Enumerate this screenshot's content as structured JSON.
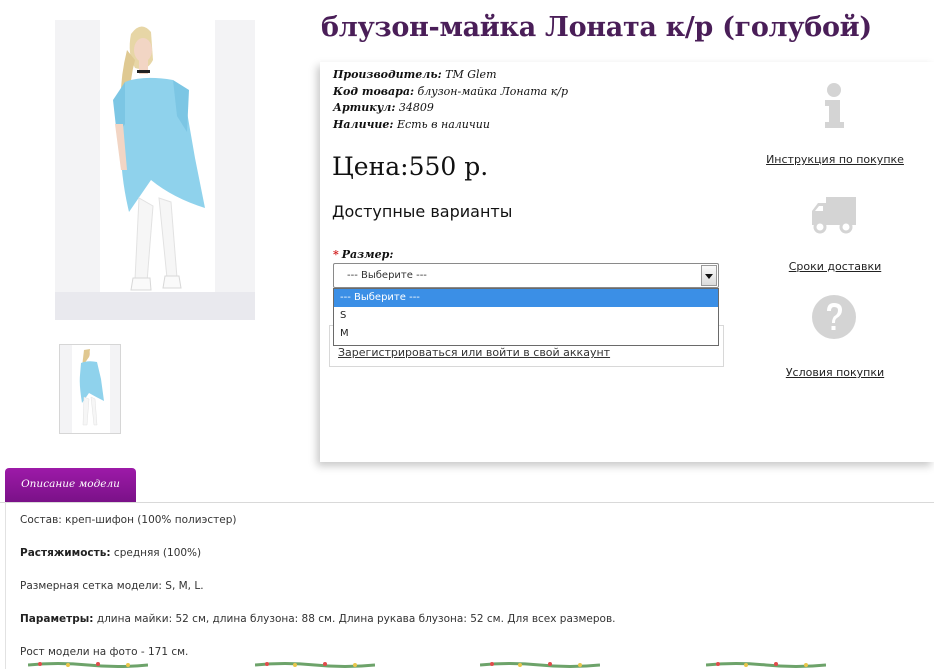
{
  "product": {
    "title": "блузон-майка Лоната к/р (голубой)",
    "info": [
      {
        "label": "Производитель:",
        "value": " TM Glem"
      },
      {
        "label": "Код товара:",
        "value": " блузон-майка Лоната к/р"
      },
      {
        "label": "Артикул:",
        "value": " 34809"
      },
      {
        "label": "Наличие:",
        "value": " Есть в наличии"
      }
    ],
    "price": "Цена:550 р.",
    "variants_heading": "Доступные варианты",
    "size": {
      "label": "Размер:",
      "required_mark": "*",
      "selected": "--- Выберите ---",
      "options": [
        "--- Выберите ---",
        "S",
        "M"
      ]
    },
    "login_link": "Зарегистрироваться или войти в свой аккаунт",
    "colors": {
      "title": "#4a1e58",
      "tab": "#8a1698",
      "highlight": "#3b8fe6"
    }
  },
  "side_links": [
    {
      "icon": "info-icon",
      "label": "Инструкция по покупке"
    },
    {
      "icon": "truck-icon",
      "label": "Сроки доставки"
    },
    {
      "icon": "question-icon",
      "label": "Условия покупки"
    }
  ],
  "description": {
    "tab_label": "Описание модели",
    "lines": [
      {
        "label": "",
        "value": "Состав: креп-шифон (100% полиэстер)"
      },
      {
        "label": "Растяжимость:",
        "value": " средняя (100%)"
      },
      {
        "label": "",
        "value": "Размерная сетка модели: S, M, L."
      },
      {
        "label": "Параметры:",
        "value": " длина майки: 52 см, длина блузона: 88 см. Длина рукава блузона: 52 см. Для всех размеров."
      },
      {
        "label": "",
        "value": "Рост модели на фото - 171 см."
      }
    ]
  }
}
